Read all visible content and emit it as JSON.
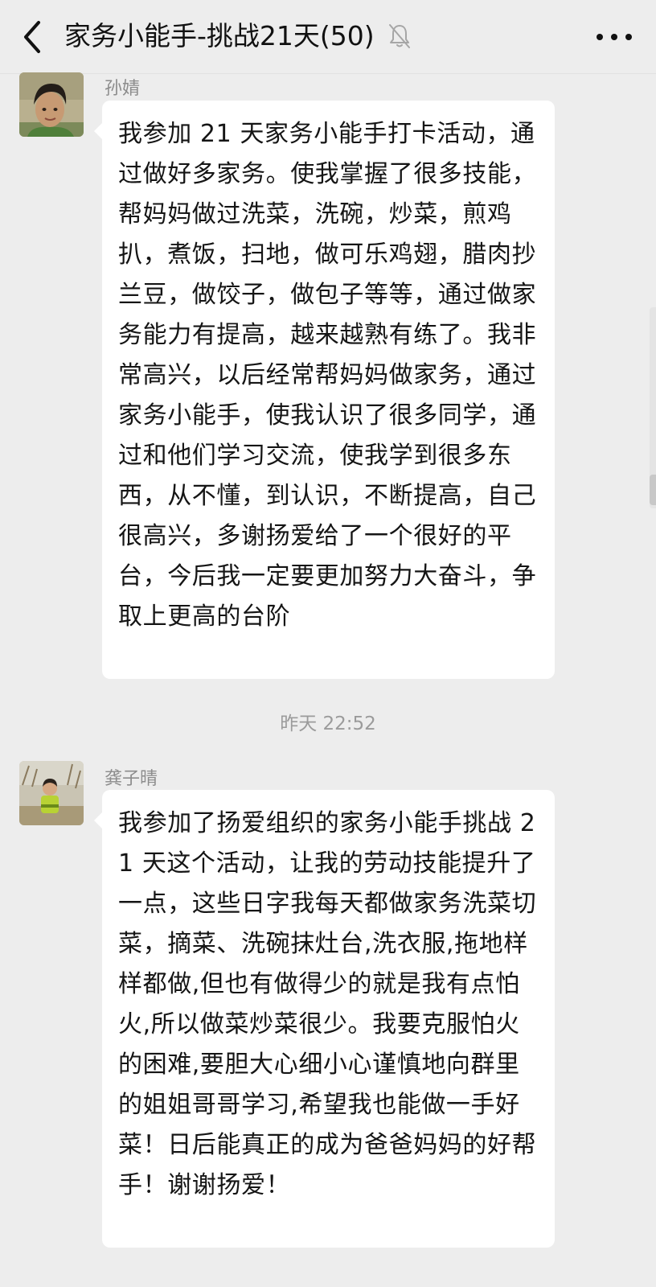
{
  "header": {
    "title": "家务小能手-挑战21天(50)",
    "back_icon": "chevron-left-icon",
    "mute_icon": "bell-muted-icon",
    "more_icon": "more-dots-icon"
  },
  "messages": [
    {
      "sender": "孙婧",
      "avatar": "avatar-photo",
      "text": "我参加 21 天家务小能手打卡活动，通过做好多家务。使我掌握了很多技能，帮妈妈做过洗菜，洗碗，炒菜，煎鸡扒，煮饭，扫地，做可乐鸡翅，腊肉抄兰豆，做饺子，做包子等等，通过做家务能力有提高，越来越熟有练了。我非常高兴，以后经常帮妈妈做家务，通过家务小能手，使我认识了很多同学，通过和他们学习交流，使我学到很多东西，从不懂，到认识，不断提高，自己很高兴，多谢扬爱给了一个很好的平台，今后我一定要更加努力大奋斗，争取上更高的台阶"
    },
    {
      "sender": "龚子晴",
      "avatar": "avatar-photo",
      "text": "我参加了扬爱组织的家务小能手挑战 21 天这个活动，让我的劳动技能提升了一点，这些日字我每天都做家务洗菜切菜，摘菜、洗碗抹灶台,洗衣服,拖地样样都做,但也有做得少的就是我有点怕火,所以做菜炒菜很少。我要克服怕火的困难,要胆大心细小心谨慎地向群里的姐姐哥哥学习,希望我也能做一手好菜！日后能真正的成为爸爸妈妈的好帮手！谢谢扬爱！"
    }
  ],
  "timestamp": "昨天 22:52",
  "colors": {
    "background": "#ededed",
    "bubble": "#ffffff",
    "sender_text": "#8c8c8c",
    "timestamp_text": "#9b9b9b"
  }
}
